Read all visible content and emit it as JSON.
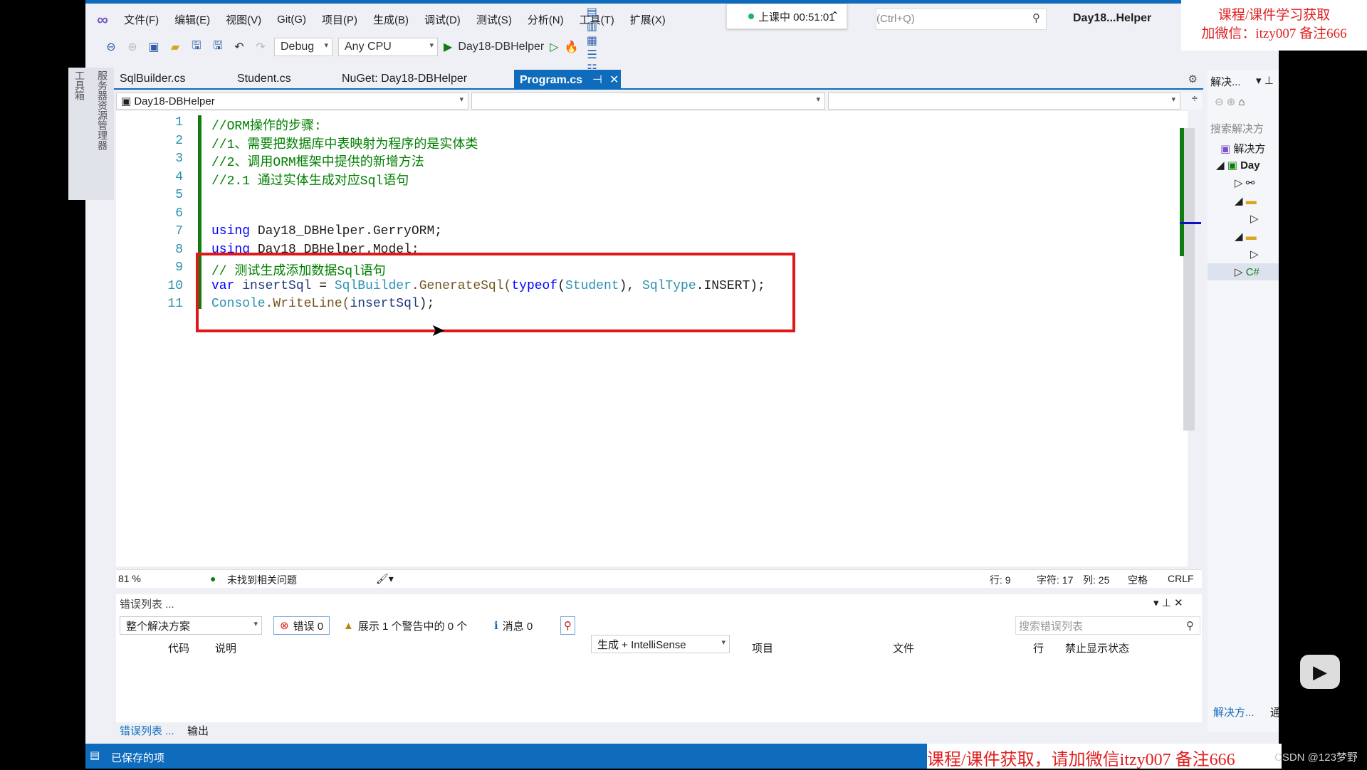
{
  "menu": [
    "文件(F)",
    "编辑(E)",
    "视图(V)",
    "Git(G)",
    "项目(P)",
    "生成(B)",
    "调试(D)",
    "测试(S)",
    "分析(N)",
    "工具(T)",
    "扩展(X)"
  ],
  "timer": "上课中 00:51:01",
  "search_placeholder": "(Ctrl+Q)",
  "window_title": "Day18...Helper",
  "watermark_top": [
    "课程/课件学习获取",
    "加微信：itzy007 备注666"
  ],
  "toolbar": {
    "config": "Debug",
    "platform": "Any CPU",
    "run_target": "Day18-DBHelper"
  },
  "tabs": [
    "SqlBuilder.cs",
    "Student.cs",
    "NuGet: Day18-DBHelper",
    "Program.cs"
  ],
  "active_tab": "Program.cs",
  "vertical_tabs": [
    "服务器资源管理器",
    "工具箱"
  ],
  "nav": {
    "project": "Day18-DBHelper"
  },
  "code": [
    {
      "n": "1",
      "t": [
        [
          "cm",
          "//ORM操作的步骤:"
        ]
      ]
    },
    {
      "n": "2",
      "t": [
        [
          "cm",
          "//1、需要把数据库中表映射为程序的是实体类"
        ]
      ]
    },
    {
      "n": "3",
      "t": [
        [
          "cm",
          "//2、调用ORM框架中提供的新增方法"
        ]
      ]
    },
    {
      "n": "4",
      "t": [
        [
          "cm",
          "//2.1 通过实体生成对应Sql语句"
        ]
      ]
    },
    {
      "n": "5",
      "t": []
    },
    {
      "n": "6",
      "t": []
    },
    {
      "n": "7",
      "t": [
        [
          "kw",
          "using"
        ],
        [
          "",
          "Day18_DBHelper.GerryORM;"
        ]
      ]
    },
    {
      "n": "8",
      "t": [
        [
          "kw",
          "using"
        ],
        [
          "",
          "Day18_DBHelper.Model;"
        ]
      ]
    },
    {
      "n": "9",
      "t": [
        [
          "cm",
          "// 测试生成添加数据Sql语句"
        ]
      ]
    },
    {
      "n": "10",
      "t": [
        [
          "kw",
          "var"
        ],
        [
          "id",
          "insertSql"
        ],
        [
          "",
          "="
        ],
        [
          "ty",
          "SqlBuilder"
        ],
        [
          "mt",
          ".GenerateSql("
        ],
        [
          "kw",
          "typeof"
        ],
        [
          "",
          "("
        ],
        [
          "ty",
          "Student"
        ],
        [
          "",
          "),"
        ],
        [
          "ty",
          "SqlType"
        ],
        [
          "",
          ".INSERT);"
        ]
      ]
    },
    {
      "n": "11",
      "t": [
        [
          "ty",
          "Console"
        ],
        [
          "mt",
          ".WriteLine("
        ],
        [
          "id",
          "insertSql"
        ],
        [
          "",
          ");"
        ]
      ]
    }
  ],
  "editor_status": {
    "zoom": "81 %",
    "issues": "未找到相关问题",
    "line": "行: 9",
    "char": "字符: 17",
    "col": "列: 25",
    "spaces": "空格",
    "eol": "CRLF"
  },
  "error_list": {
    "title": "错误列表 ...",
    "scope": "整个解决方案",
    "errors": "错误 0",
    "warnings": "展示 1 个警告中的 0 个",
    "messages": "消息 0",
    "source": "生成 + IntelliSense",
    "search_placeholder": "搜索错误列表",
    "columns": [
      "代码",
      "说明",
      "项目",
      "文件",
      "行",
      "禁止显示状态"
    ]
  },
  "bottom_tabs": [
    "错误列表 ...",
    "输出"
  ],
  "status_text": "已保存的项",
  "watermark_bottom": "课程/课件获取，请加微信itzy007 备注666",
  "csdn": "CSDN @123梦野",
  "solution_explorer": {
    "title": "解决...",
    "search": "搜索解决方",
    "root": "解决方",
    "project": "Day",
    "bottom_tab": "解决方...",
    "bottom_tab2": "通"
  }
}
